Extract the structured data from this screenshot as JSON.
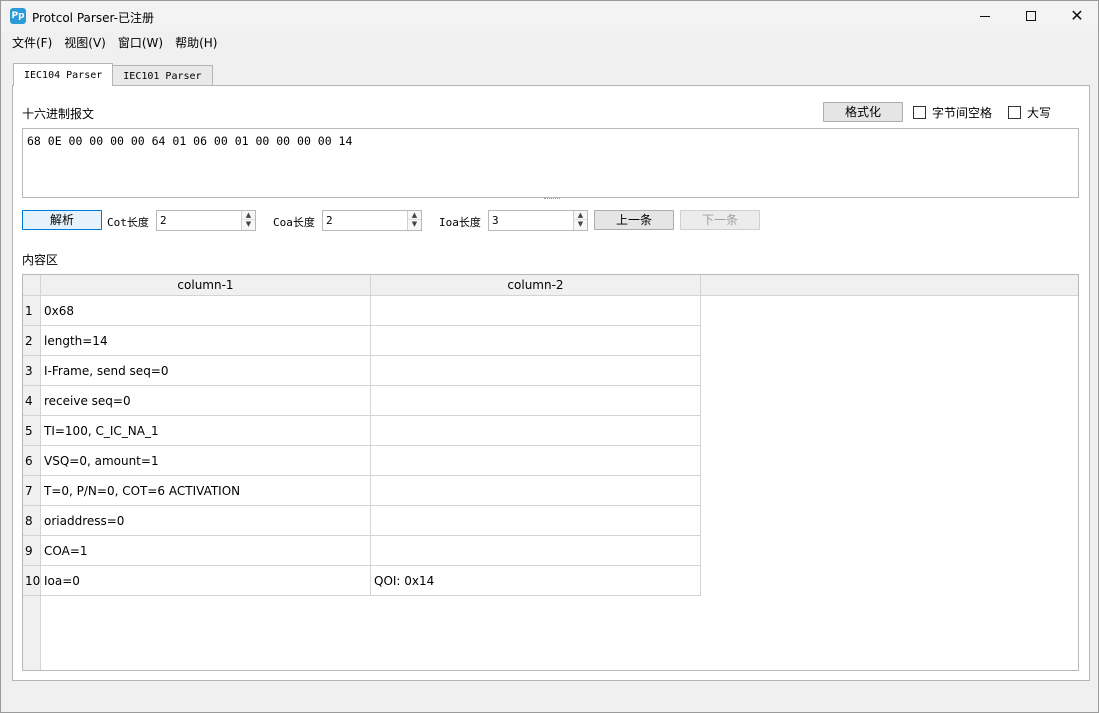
{
  "window": {
    "title": "Protcol Parser-已注册",
    "icon_text": "Pp"
  },
  "menu": [
    "文件(F)",
    "视图(V)",
    "窗口(W)",
    "帮助(H)"
  ],
  "tabs": [
    "IEC104 Parser",
    "IEC101 Parser"
  ],
  "hex_section": {
    "label": "十六进制报文",
    "value": "68 0E 00 00 00 00 64 01 06 00 01 00 00 00 00 14",
    "format_button": "格式化",
    "space_checkbox": "字节间空格",
    "upper_checkbox": "大写"
  },
  "controls": {
    "parse_button": "解析",
    "cot_label": "Cot长度",
    "cot_value": "2",
    "coa_label": "Coa长度",
    "coa_value": "2",
    "ioa_label": "Ioa长度",
    "ioa_value": "3",
    "prev_button": "上一条",
    "next_button": "下一条"
  },
  "content": {
    "label": "内容区",
    "columns": [
      "column-1",
      "column-2"
    ],
    "rows": [
      {
        "num": "1",
        "c1": "0x68",
        "c2": ""
      },
      {
        "num": "2",
        "c1": "length=14",
        "c2": ""
      },
      {
        "num": "3",
        "c1": "I-Frame, send seq=0",
        "c2": ""
      },
      {
        "num": "4",
        "c1": "receive seq=0",
        "c2": ""
      },
      {
        "num": "5",
        "c1": "TI=100, C_IC_NA_1",
        "c2": ""
      },
      {
        "num": "6",
        "c1": "VSQ=0, amount=1",
        "c2": ""
      },
      {
        "num": "7",
        "c1": "T=0, P/N=0, COT=6 ACTIVATION",
        "c2": ""
      },
      {
        "num": "8",
        "c1": "oriaddress=0",
        "c2": ""
      },
      {
        "num": "9",
        "c1": "COA=1",
        "c2": ""
      },
      {
        "num": "10",
        "c1": "Ioa=0",
        "c2": "QOI: 0x14"
      }
    ]
  },
  "colors": {
    "accent": "#0078d7",
    "icon_bg": "#2b9bd8"
  }
}
